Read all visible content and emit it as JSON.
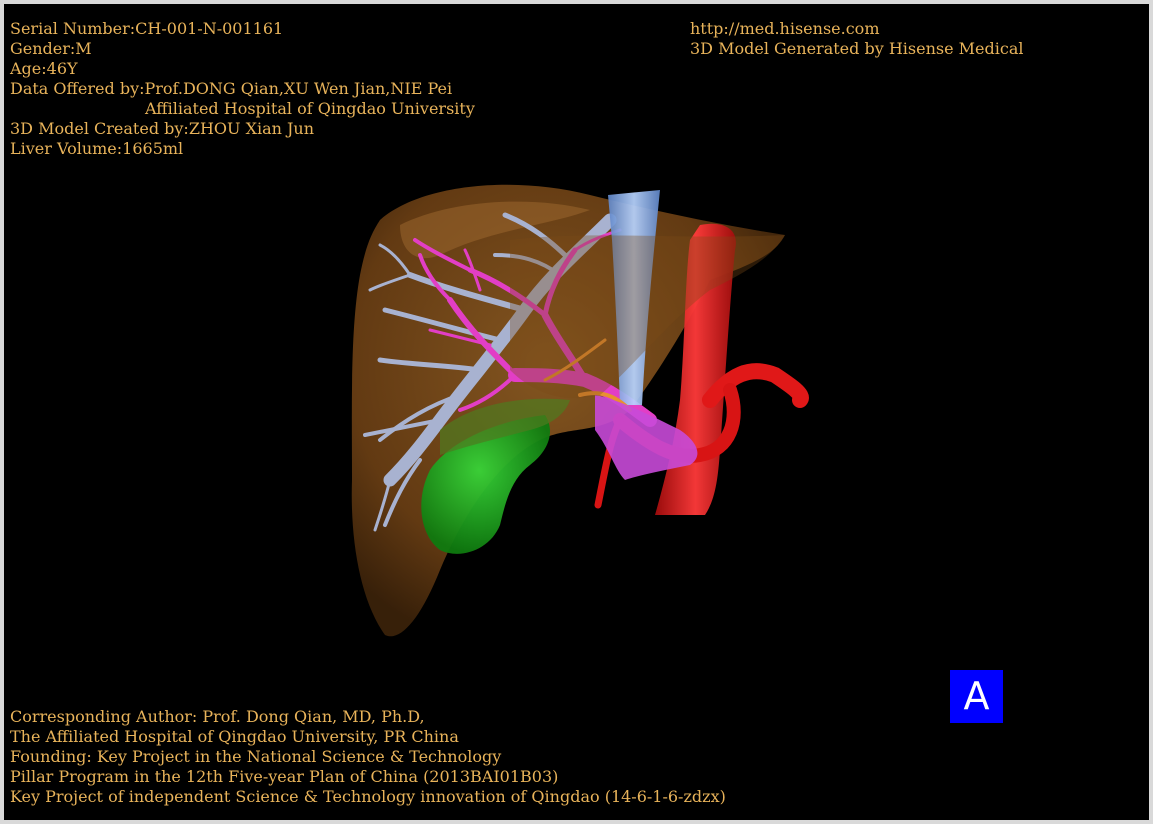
{
  "header_left": {
    "serial_number": "Serial Number:CH-001-N-001161",
    "gender": "Gender:M",
    "age": "Age:46Y",
    "data_offered_by": "Data Offered by:Prof.DONG Qian,XU Wen Jian,NIE Pei",
    "hospital": "Affiliated Hospital of Qingdao University",
    "model_created_by": "3D Model Created by:ZHOU Xian Jun",
    "liver_volume": "Liver Volume:1665ml"
  },
  "header_right": {
    "url": "http://med.hisense.com",
    "generated_by": "3D Model Generated by Hisense Medical"
  },
  "footer": {
    "line1": "Corresponding Author: Prof. Dong Qian, MD, Ph.D,",
    "line2": "The Affiliated Hospital of Qingdao University, PR China",
    "line3": "Founding: Key Project in the National Science & Technology",
    "line4": "Pillar Program in the 12th Five-year Plan of China (2013BAI01B03)",
    "line5": "Key Project of independent Science & Technology innovation of Qingdao (14-6-1-6-zdzx)"
  },
  "view_badge": "A",
  "colors": {
    "text": "#e8b35a",
    "liver": "#6b3f14",
    "hepatic_vein": "#a8b2d0",
    "portal_vein": "#e23ec6",
    "artery": "#e01818",
    "ivc": "#7aa8e8",
    "gallbladder": "#1fa51f",
    "badge": "#0000ff"
  }
}
